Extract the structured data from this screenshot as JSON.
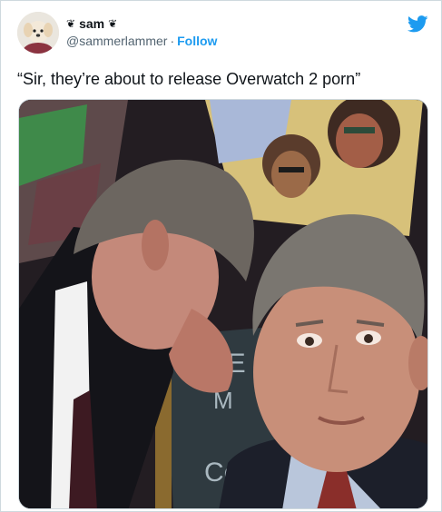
{
  "author": {
    "display_name": "sam",
    "name_emoji_left": "❦",
    "name_emoji_right": "❦",
    "handle": "@sammerlammer",
    "separator": "·",
    "follow_label": "Follow"
  },
  "tweet": {
    "text": "“Sir, they’re about to release Overwatch 2 porn”"
  },
  "media": {
    "chalkboard_text": [
      "RE",
      "M",
      "Co"
    ]
  },
  "colors": {
    "accent": "#1d9bf0",
    "text_primary": "#0f1419",
    "text_secondary": "#536471",
    "border": "#cfd9de"
  },
  "icons": {
    "brand": "twitter-bird-icon"
  }
}
